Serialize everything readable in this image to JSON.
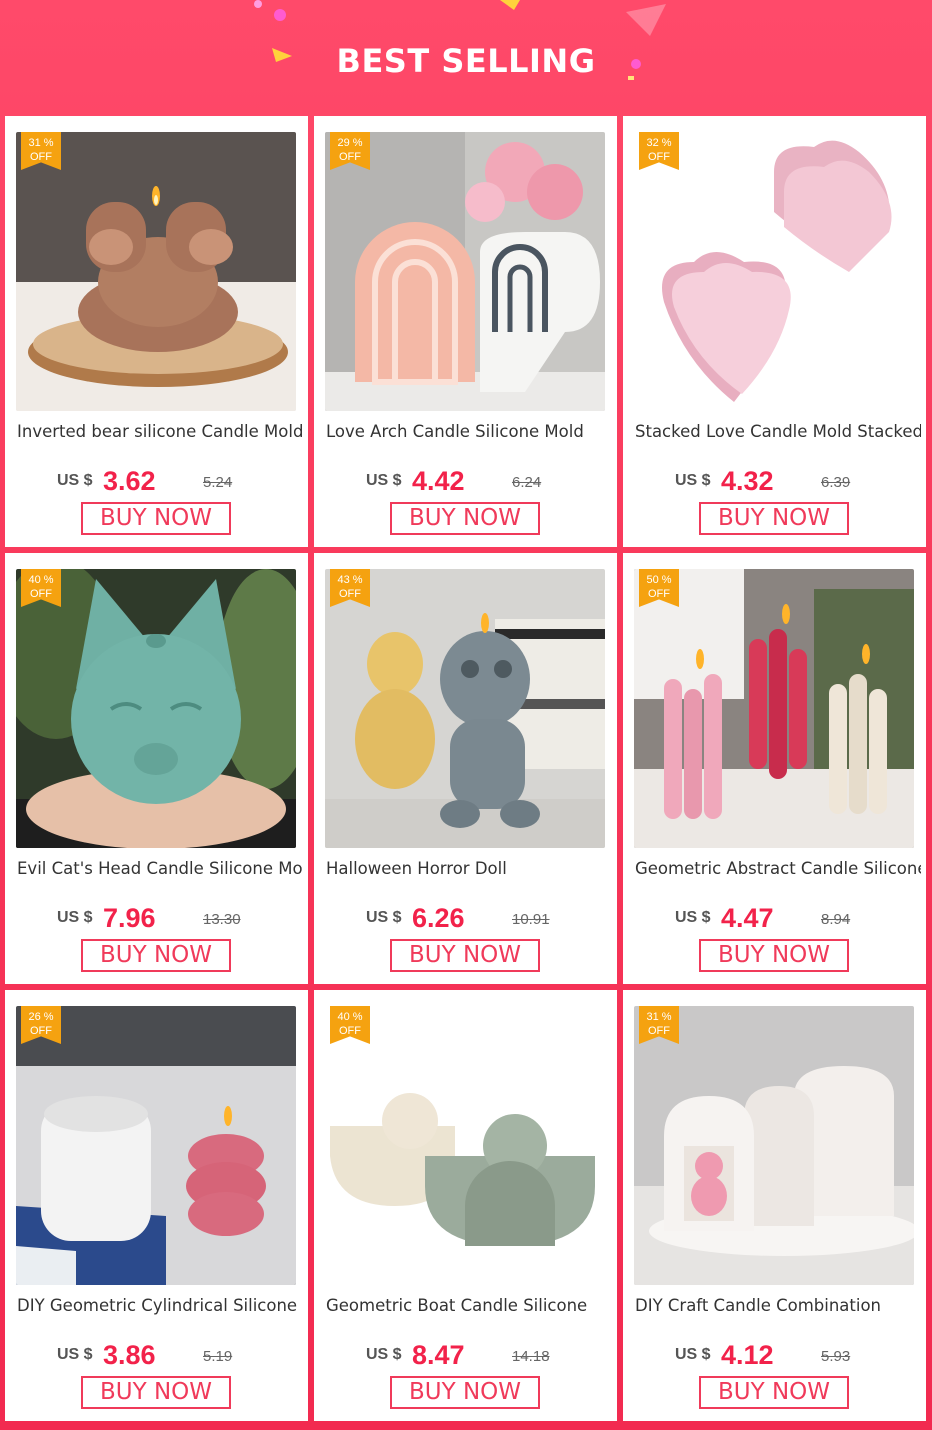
{
  "header": {
    "title": "BEST SELLING"
  },
  "colors": {
    "accent": "#f2224a",
    "badge": "#f5a210",
    "background": "#f8385a"
  },
  "products": [
    {
      "discount": "31 %",
      "off": "OFF",
      "name": "Inverted bear silicone Candle Mold",
      "currency": "US $",
      "price": "3.62",
      "original": "5.24",
      "cta": "BUY NOW",
      "image": "bear-candle-photo"
    },
    {
      "discount": "29 %",
      "off": "OFF",
      "name": "Love Arch Candle Silicone Mold",
      "currency": "US $",
      "price": "4.42",
      "original": "6.24",
      "cta": "BUY NOW",
      "image": "arch-candle-photo"
    },
    {
      "discount": "32 %",
      "off": "OFF",
      "name": "Stacked Love Candle Mold Stacked",
      "currency": "US $",
      "price": "4.32",
      "original": "6.39",
      "cta": "BUY NOW",
      "image": "heart-candle-photo"
    },
    {
      "discount": "40 %",
      "off": "OFF",
      "name": "Evil Cat's Head Candle Silicone Mold",
      "currency": "US $",
      "price": "7.96",
      "original": "13.30",
      "cta": "BUY NOW",
      "image": "cat-head-candle-photo"
    },
    {
      "discount": "43 %",
      "off": "OFF",
      "name": "Halloween Horror Doll",
      "currency": "US $",
      "price": "6.26",
      "original": "10.91",
      "cta": "BUY NOW",
      "image": "horror-doll-candle-photo"
    },
    {
      "discount": "50 %",
      "off": "OFF",
      "name": "Geometric Abstract Candle Silicone",
      "currency": "US $",
      "price": "4.47",
      "original": "8.94",
      "cta": "BUY NOW",
      "image": "pillar-candle-photo"
    },
    {
      "discount": "26 %",
      "off": "OFF",
      "name": "DIY Geometric Cylindrical Silicone",
      "currency": "US $",
      "price": "3.86",
      "original": "5.19",
      "cta": "BUY NOW",
      "image": "cylinder-candle-photo"
    },
    {
      "discount": "40 %",
      "off": "OFF",
      "name": "Geometric Boat Candle Silicone",
      "currency": "US $",
      "price": "8.47",
      "original": "14.18",
      "cta": "BUY NOW",
      "image": "boat-candle-photo"
    },
    {
      "discount": "31 %",
      "off": "OFF",
      "name": "DIY Craft Candle Combination",
      "currency": "US $",
      "price": "4.12",
      "original": "5.93",
      "cta": "BUY NOW",
      "image": "combination-candle-photo"
    }
  ]
}
